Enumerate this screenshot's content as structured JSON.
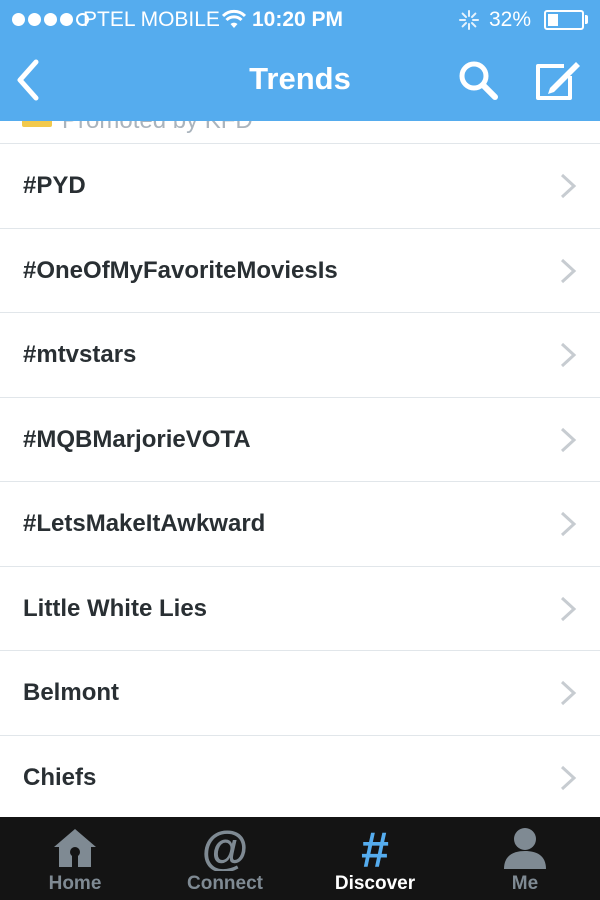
{
  "status_bar": {
    "carrier": "PTEL MOBILE",
    "time": "10:20 PM",
    "battery_percent": "32%",
    "battery_level": 0.32,
    "signal_bars_filled": 4,
    "signal_bars_total": 5
  },
  "nav": {
    "title": "Trends",
    "back_icon": "chevron-left-icon",
    "search_icon": "search-icon",
    "compose_icon": "compose-icon"
  },
  "promoted": {
    "label": "Promoted by KFD"
  },
  "trends": [
    {
      "label": "#PYD"
    },
    {
      "label": "#OneOfMyFavoriteMoviesIs"
    },
    {
      "label": "#mtvstars"
    },
    {
      "label": "#MQBMarjorieVOTA"
    },
    {
      "label": "#LetsMakeItAwkward"
    },
    {
      "label": "Little White Lies"
    },
    {
      "label": "Belmont"
    },
    {
      "label": "Chiefs"
    }
  ],
  "tabs": [
    {
      "label": "Home",
      "icon": "home-icon",
      "active": false
    },
    {
      "label": "Connect",
      "icon": "at-sign-icon",
      "active": false
    },
    {
      "label": "Discover",
      "icon": "hashtag-icon",
      "active": true
    },
    {
      "label": "Me",
      "icon": "person-icon",
      "active": false
    }
  ],
  "colors": {
    "header_blue": "#55acee",
    "accent_blue": "#55acee",
    "tabbar_bg": "#141414",
    "inactive_tab": "#7f8a93",
    "row_text": "#292f33",
    "divider": "#e1e6ea"
  }
}
